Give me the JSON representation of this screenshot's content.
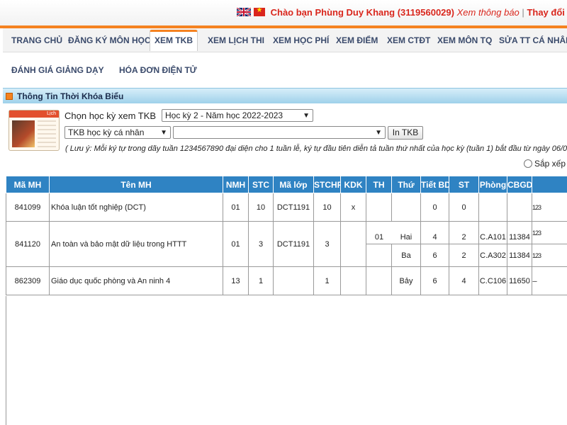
{
  "header": {
    "greeting_name": "Chào bạn Phùng Duy Khang (3119560029)",
    "view_notice": "Xem thông báo",
    "separator": "|",
    "change_link": "Thay đổi m..."
  },
  "nav": {
    "tabs": [
      {
        "label": "TRANG CHỦ"
      },
      {
        "label": "ĐĂNG KÝ MÔN HỌC"
      },
      {
        "label": "XEM TKB"
      },
      {
        "label": "XEM LỊCH THI"
      },
      {
        "label": "XEM HỌC PHÍ"
      },
      {
        "label": "XEM ĐIỂM"
      },
      {
        "label": "XEM CTĐT"
      },
      {
        "label": "XEM MÔN TQ"
      },
      {
        "label": "SỬA TT CÁ NHÂN"
      }
    ],
    "active_tab": "XEM TKB",
    "sub_items": [
      {
        "label": "ĐÁNH GIÁ GIẢNG DẠY"
      },
      {
        "label": "HÓA ĐƠN ĐIỆN TỬ"
      }
    ]
  },
  "panel": {
    "title": "Thông Tin Thời Khóa Biểu",
    "calendar_label": "Lịch",
    "semester_label": "Chọn học kỳ xem TKB",
    "semester_value": "Học kỳ 2 - Năm học 2022-2023",
    "tkb_type_value": "TKB học kỳ cá nhân",
    "week_value": "",
    "print_button": "In TKB",
    "note": "( Lưu ý: Mỗi ký tự trong dãy tuần 1234567890 đại diện cho 1 tuần lễ, ký tự đầu tiên diễn tả tuần thứ nhất của học kỳ (tuần 1) bắt đầu từ ngày 06/02/",
    "sort_label": "Sắp xếp"
  },
  "table": {
    "headers": [
      "Mã MH",
      "Tên MH",
      "NMH",
      "STC",
      "Mã lớp",
      "STCHP",
      "KDK",
      "TH",
      "Thứ",
      "Tiết BD",
      "ST",
      "Phòng",
      "CBGD",
      ""
    ],
    "rows": [
      {
        "ma_mh": "841099",
        "ten_mh": "Khóa luận tốt nghiệp (DCT)",
        "nmh": "01",
        "stc": "10",
        "ma_lop": "DCT1191",
        "stchp": "10",
        "kdk": "x",
        "sessions": [
          {
            "th": "",
            "thu": "",
            "tiet_bd": "0",
            "st": "0",
            "phong": "",
            "cbgd": "",
            "tuan": "123"
          }
        ]
      },
      {
        "ma_mh": "841120",
        "ten_mh": "An toàn và bảo mật dữ liệu trong HTTT",
        "nmh": "01",
        "stc": "3",
        "ma_lop": "DCT1191",
        "stchp": "3",
        "kdk": "",
        "sessions": [
          {
            "th": "01",
            "thu": "Hai",
            "tiet_bd": "4",
            "st": "2",
            "phong": "C.A101",
            "cbgd": "11384",
            "tuan": "123"
          },
          {
            "th": "",
            "thu": "Ba",
            "tiet_bd": "6",
            "st": "2",
            "phong": "C.A302",
            "cbgd": "11384",
            "tuan": "123"
          }
        ]
      },
      {
        "ma_mh": "862309",
        "ten_mh": "Giáo dục quốc phòng và An ninh 4",
        "nmh": "13",
        "stc": "1",
        "ma_lop": "",
        "stchp": "1",
        "kdk": "",
        "sessions": [
          {
            "th": "",
            "thu": "Bảy",
            "tiet_bd": "6",
            "st": "4",
            "phong": "C.C106",
            "cbgd": "11650",
            "tuan": "---"
          }
        ]
      }
    ]
  },
  "colors": {
    "accent_orange": "#f58220",
    "header_red": "#d9261c",
    "table_header_blue": "#2f83c3",
    "panel_header_blue": "#9fd1ea"
  }
}
